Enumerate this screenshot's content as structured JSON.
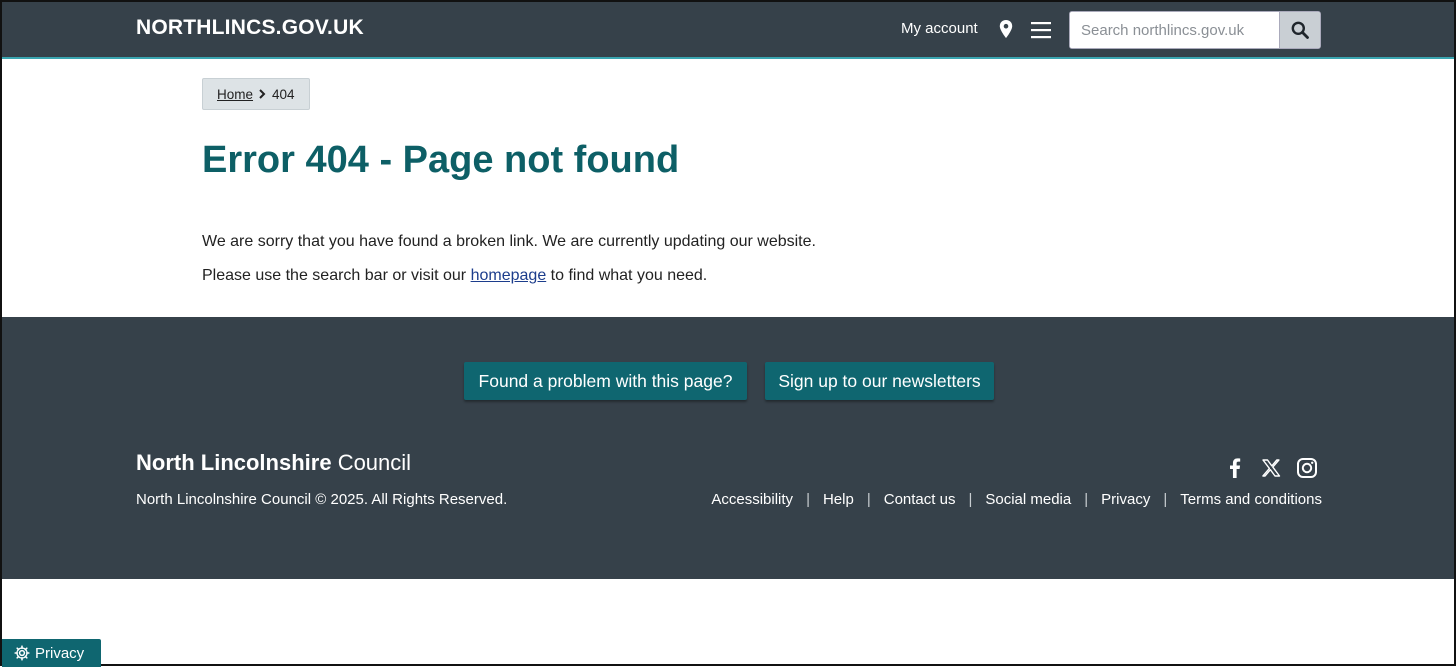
{
  "header": {
    "brand": "NORTHLINCS.GOV.UK",
    "my_account": "My account",
    "location_icon": "map-pin-icon",
    "menu_icon": "hamburger-menu-icon",
    "search": {
      "placeholder": "Search northlincs.gov.uk",
      "value": "",
      "button_icon": "search-icon"
    }
  },
  "breadcrumb": {
    "home": "Home",
    "current": "404"
  },
  "main": {
    "title": "Error 404 - Page not found",
    "para1": "We are sorry that you have found a broken link. We are currently updating our website.",
    "para2_before": "Please use the search bar or visit our",
    "para2_link": "homepage",
    "para2_after": "to find what you need."
  },
  "footer": {
    "buttons": [
      "Found a problem with this page?",
      "Sign up to our newsletters"
    ],
    "logo_strong": "North Lincolnshire",
    "logo_light": "Council",
    "copyright": "North Lincolnshire Council © 2025. All Rights Reserved.",
    "social_icons": [
      "facebook-icon",
      "x-icon",
      "instagram-icon"
    ],
    "links": [
      "Accessibility",
      "Help",
      "Contact us",
      "Social media",
      "Privacy",
      "Terms and conditions"
    ],
    "separator": "|"
  },
  "privacy_tab": {
    "label": "Privacy",
    "icon": "gear-icon"
  },
  "colors": {
    "header_bg": "#36414a",
    "header_accent": "#3aa5b0",
    "title": "#0d5f66",
    "button_bg": "#0f6670",
    "link": "#1c3d8c"
  }
}
